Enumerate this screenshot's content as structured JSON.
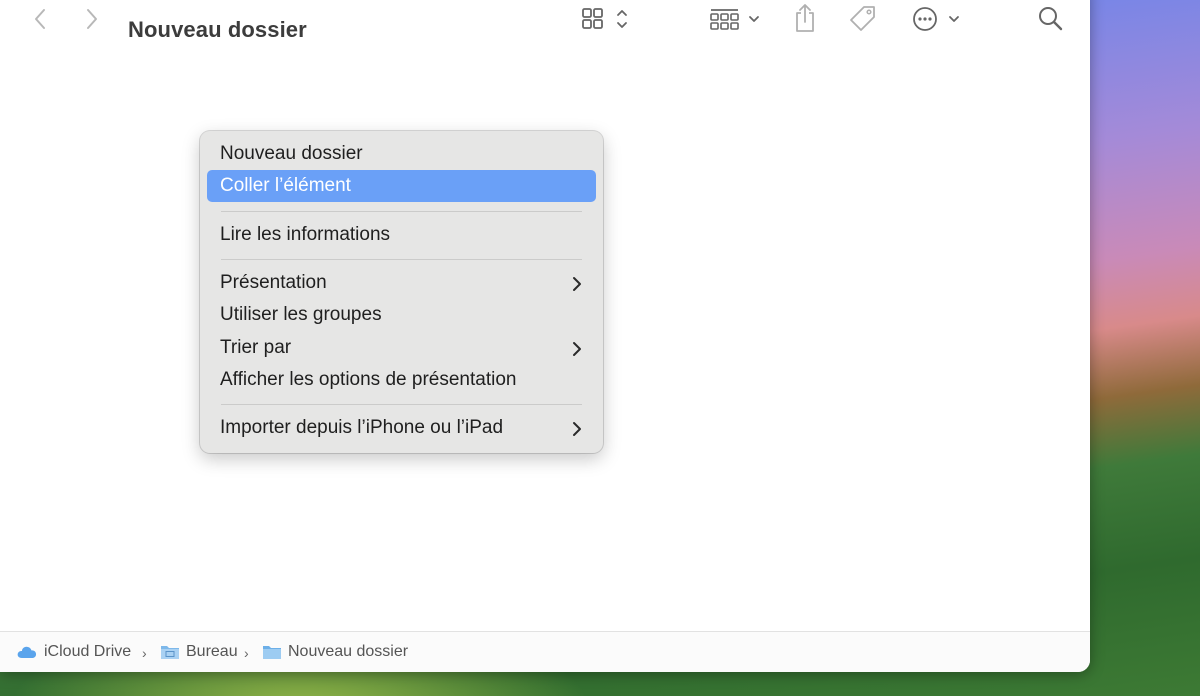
{
  "window": {
    "title": "Nouveau dossier"
  },
  "toolbar": {
    "back": "chevron-left-icon",
    "forward": "chevron-right-icon",
    "view_icon": "grid-icon",
    "group_icon": "group-grid-icon",
    "share_icon": "share-icon",
    "tag_icon": "tag-icon",
    "more_icon": "ellipsis-circle-icon",
    "search_icon": "search-icon"
  },
  "context_menu": {
    "items": [
      {
        "label": "Nouveau dossier",
        "submenu": false
      },
      {
        "label": "Coller l’élément",
        "submenu": false,
        "selected": true
      },
      {
        "label": "Lire les informations",
        "submenu": false
      },
      {
        "label": "Présentation",
        "submenu": true
      },
      {
        "label": "Utiliser les groupes",
        "submenu": false
      },
      {
        "label": "Trier par",
        "submenu": true
      },
      {
        "label": "Afficher les options de présentation",
        "submenu": false
      },
      {
        "label": "Importer depuis l’iPhone ou l’iPad",
        "submenu": true
      }
    ],
    "highlight_color": "#6aa0f7"
  },
  "pathbar": {
    "crumbs": [
      {
        "label": "iCloud Drive",
        "icon": "cloud-icon"
      },
      {
        "label": "Bureau",
        "icon": "desktop-folder-icon"
      },
      {
        "label": "Nouveau dossier",
        "icon": "folder-icon"
      }
    ]
  }
}
